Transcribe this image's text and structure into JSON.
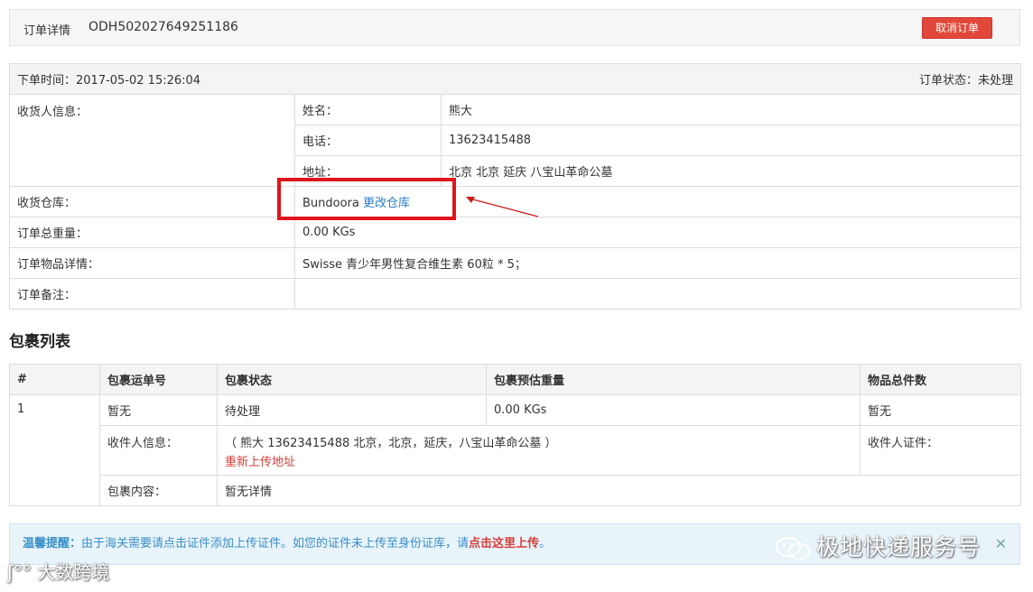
{
  "header": {
    "label": "订单详情",
    "order_id": "ODH502027649251186",
    "cancel_button": "取消订单"
  },
  "order": {
    "order_time": "下单时间：2017-05-02 15:26:04",
    "status": "订单状态：未处理",
    "receiver_label": "收货人信息：",
    "name_label": "姓名：",
    "name_value": "熊大",
    "phone_label": "电话：",
    "phone_value": "13623415488",
    "address_label": "地址：",
    "address_value": "北京 北京 延庆 八宝山革命公墓",
    "warehouse_label": "收货仓库：",
    "warehouse_value": "Bundoora",
    "change_warehouse_link": "更改仓库",
    "weight_label": "订单总重量：",
    "weight_value": "0.00 KGs",
    "items_label": "订单物品详情：",
    "items_value": "Swisse 青少年男性复合维生素 60粒 * 5；",
    "remark_label": "订单备注：",
    "remark_value": ""
  },
  "packages": {
    "title": "包裹列表",
    "columns": [
      "#",
      "包裹运单号",
      "包裹状态",
      "包裹预估重量",
      "物品总件数"
    ],
    "rows": [
      {
        "index": "1",
        "tracking": "暂无",
        "status": "待处理",
        "weight": "0.00 KGs",
        "count": "暂无",
        "recipient_label": "收件人信息：",
        "recipient_value": "（ 熊大  13623415488  北京，北京，延庆，八宝山革命公墓 ）",
        "reupload_link": "重新上传地址",
        "id_label": "收件人证件：",
        "content_label": "包裹内容：",
        "content_value": "暂无详情"
      }
    ]
  },
  "tip": {
    "prefix": "温馨提醒：",
    "text": "由于海关需要请点击证件添加上传证件。如您的证件未上传至身份证库，请",
    "link": "点击这里上传",
    "suffix": "。",
    "close": "✕"
  },
  "watermarks": {
    "wechat": "极地快递服务号",
    "brand": "大数跨境"
  },
  "colors": {
    "cancel_button": "#e2483a",
    "highlight": "#e0141b",
    "link": "#2a7bc9",
    "tip_background": "#e8f3fa"
  }
}
